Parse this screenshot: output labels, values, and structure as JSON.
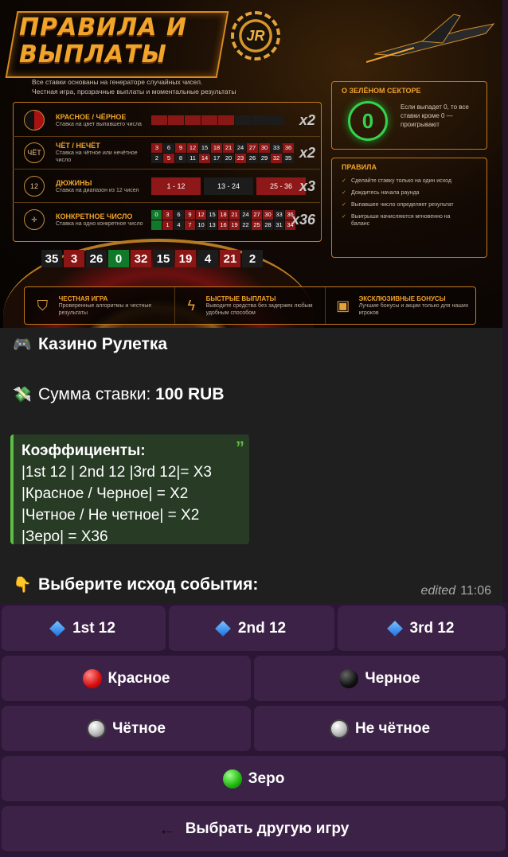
{
  "banner": {
    "title": "ПРАВИЛА И ВЫПЛАТЫ",
    "chip_logo": "JR",
    "subtitle_1": "Все ставки основаны на генераторе случайных чисел.",
    "subtitle_2": "Честная игра, прозрачные выплаты и моментальные результаты",
    "bets": [
      {
        "title": "КРАСНОЕ / ЧЁРНОЕ",
        "desc": "Ставка на цвет выпавшего числа",
        "mult": "x2"
      },
      {
        "title": "ЧЁТ / НЕЧЁТ",
        "desc": "Ставка на чётное или нечётное число",
        "mult": "x2"
      },
      {
        "title": "ДЮЖИНЫ",
        "desc": "Ставка на диапазон из 12 чисел",
        "mult": "x3"
      },
      {
        "title": "КОНКРЕТНОЕ ЧИСЛО",
        "desc": "Ставка на одно конкретное число",
        "mult": "x36"
      }
    ],
    "even_odd_row1": [
      "3",
      "6",
      "9",
      "12",
      "15",
      "18",
      "21",
      "24",
      "27",
      "30",
      "33",
      "36"
    ],
    "even_odd_row2": [
      "2",
      "5",
      "8",
      "11",
      "14",
      "17",
      "20",
      "23",
      "26",
      "29",
      "32",
      "35"
    ],
    "dozens": [
      "1 - 12",
      "13 - 24",
      "25 - 36"
    ],
    "number_row1": [
      "0",
      "3",
      "6",
      "9",
      "12",
      "15",
      "18",
      "21",
      "24",
      "27",
      "30",
      "33",
      "36"
    ],
    "number_row2": [
      "1",
      "4",
      "7",
      "10",
      "13",
      "16",
      "19",
      "22",
      "25",
      "28",
      "31",
      "34"
    ],
    "wheel_numbers": [
      "35",
      "3",
      "26",
      "0",
      "32",
      "15",
      "19",
      "4",
      "21",
      "2"
    ],
    "zero_title": "О ЗЕЛЁНОМ СЕКТОРЕ",
    "zero_symbol": "0",
    "zero_text": "Если выпадет 0, то все ставки кроме 0 — проигрывают",
    "rules_title": "ПРАВИЛА",
    "rules": [
      "Сделайте ставку только на один исход",
      "Дождитесь начала раунда",
      "Выпавшее число определяет результат",
      "Выигрыши начисляются мгновенно на баланс"
    ],
    "features": [
      {
        "title": "ЧЕСТНАЯ ИГРА",
        "desc": "Проверенные алгоритмы и честные результаты"
      },
      {
        "title": "БЫСТРЫЕ ВЫПЛАТЫ",
        "desc": "Выводите средства без задержек любым удобным способом"
      },
      {
        "title": "ЭКСКЛЮЗИВНЫЕ БОНУСЫ",
        "desc": "Лучшие бонусы и акции только для наших игроков"
      }
    ]
  },
  "message": {
    "title_emoji": "🎮",
    "title": "Казино Рулетка",
    "bet_emoji": "💸",
    "bet_label": "Сумма ставки: ",
    "bet_value": "100 RUB",
    "quote_title": "Коэффициенты:",
    "quote_lines": [
      "|1st 12 | 2nd 12 |3rd 12|= X3",
      "|Красное / Черное| = X2",
      "|Четное / Не четное| = X2",
      "|Зеро| = X36"
    ],
    "quote_mark": "”",
    "prompt_emoji": "👇",
    "prompt": "Выберите исход события:",
    "edited": "edited",
    "time": "11:06"
  },
  "keyboard": {
    "first12": "1st 12",
    "second12": "2nd 12",
    "third12": "3rd 12",
    "red": "Красное",
    "black": "Черное",
    "even": "Чётное",
    "odd": "Не чётное",
    "zero": "Зеро",
    "back_icon": "←",
    "back": "Выбрать другую игру"
  }
}
